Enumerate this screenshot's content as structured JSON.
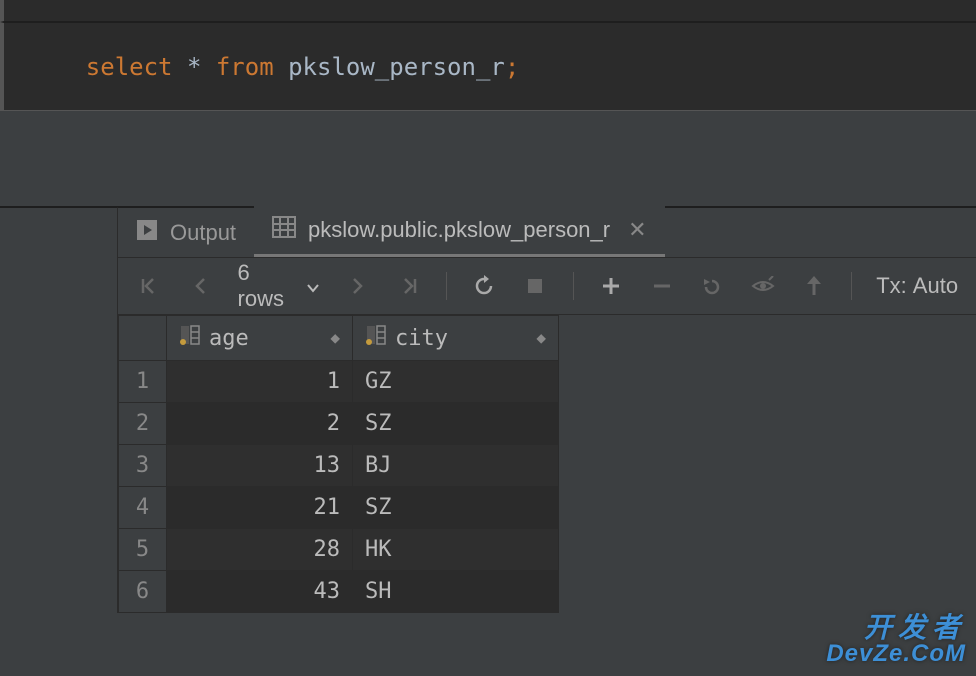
{
  "editor": {
    "sql_parts": {
      "select": "select",
      "star": "*",
      "from": "from",
      "table": "pkslow_person_r",
      "semicolon": ";"
    }
  },
  "tabs": {
    "output": {
      "label": "Output"
    },
    "result": {
      "label": "pkslow.public.pkslow_person_r"
    }
  },
  "toolbar": {
    "row_count": "6 rows",
    "tx_label": "Tx:",
    "tx_mode": "Auto"
  },
  "columns": {
    "age": "age",
    "city": "city"
  },
  "rows": [
    {
      "n": "1",
      "age": "1",
      "city": "GZ"
    },
    {
      "n": "2",
      "age": "2",
      "city": "SZ"
    },
    {
      "n": "3",
      "age": "13",
      "city": "BJ"
    },
    {
      "n": "4",
      "age": "21",
      "city": "SZ"
    },
    {
      "n": "5",
      "age": "28",
      "city": "HK"
    },
    {
      "n": "6",
      "age": "43",
      "city": "SH"
    }
  ],
  "watermark": {
    "line1": "开发者",
    "line2": "DevZe.CoM"
  }
}
